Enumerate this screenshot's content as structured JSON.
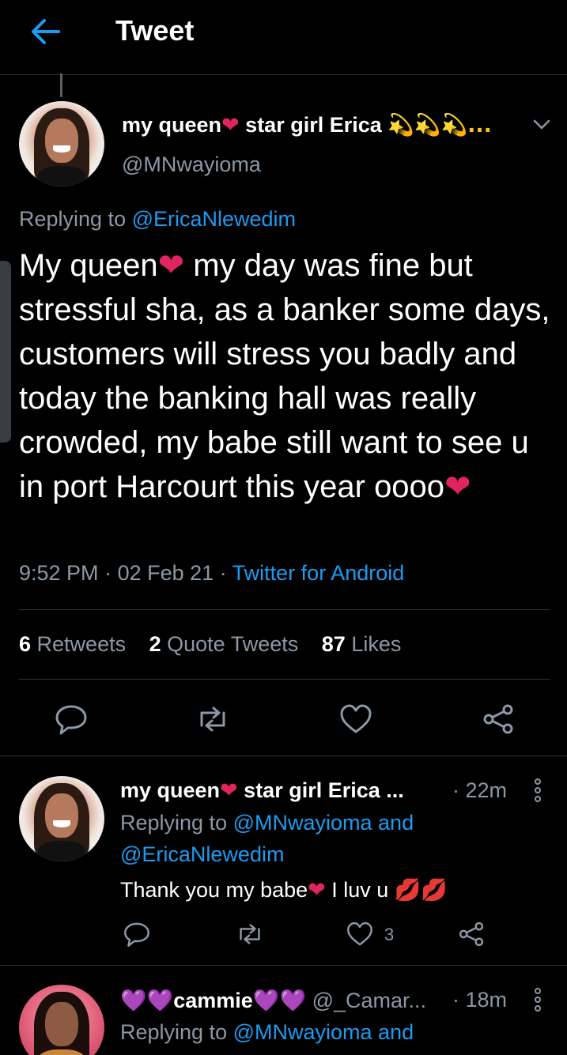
{
  "header": {
    "back_icon": "arrow-left-icon",
    "title": "Tweet"
  },
  "main_tweet": {
    "name_a": "my queen",
    "name_heart": "❤",
    "name_b": " star girl Erica ",
    "name_sparkles": "💫💫💫...",
    "handle": "@MNwayioma",
    "replying_label": "Replying to ",
    "replying_to": "@EricaNlewedim",
    "text_a": "My queen",
    "text_heart1": "❤",
    "text_b": " my day was fine but stressful sha, as a banker some days, customers will stress you badly and today the banking hall was really crowded, my babe still want to see u in port Harcourt this year oooo",
    "text_heart2": "❤",
    "time": "9:52 PM",
    "sep1": " · ",
    "date": "02 Feb 21",
    "sep2": " · ",
    "source": "Twitter for Android",
    "retweets_count": "6",
    "retweets_label": " Retweets",
    "quotes_count": "2",
    "quotes_label": " Quote Tweets",
    "likes_count": "87",
    "likes_label": " Likes"
  },
  "reply1": {
    "name_a": "my queen",
    "name_heart": "❤",
    "name_b": " star girl Erica ...",
    "time": " · 22m",
    "replying_label": "Replying to ",
    "replying_to_1": "@MNwayioma",
    "and": " and",
    "replying_to_2": "@EricaNlewedim",
    "text_a": "Thank you my babe",
    "text_heart": "❤",
    "text_b": " I luv u ",
    "text_kisses": "💋💋",
    "likes": "3"
  },
  "reply2": {
    "name_hearts_a": "💜💜",
    "name": "cammie",
    "name_hearts_b": "💜💜",
    "handle": " @_Camar...",
    "time": " · 18m",
    "replying_label": "Replying to ",
    "replying_to_1": "@MNwayioma",
    "and": " and"
  },
  "colors": {
    "background": "#000000",
    "text_primary": "#ffffff",
    "text_secondary": "#8b98a5",
    "accent": "#1d9bf0",
    "divider": "#2f3336",
    "heart": "#e0245e"
  }
}
